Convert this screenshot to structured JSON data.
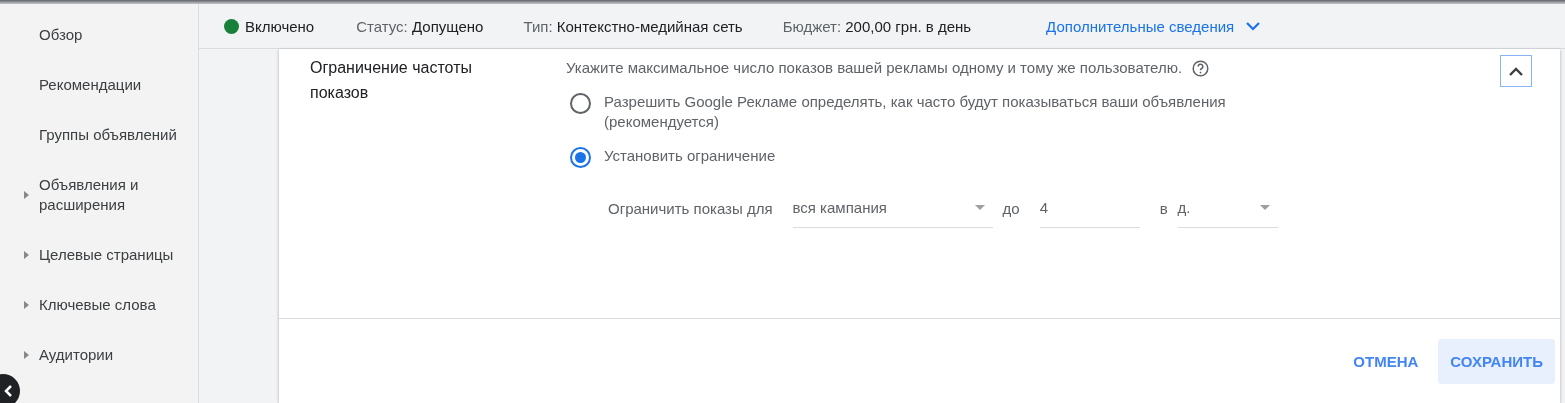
{
  "sidebar": {
    "items": [
      {
        "label": "Обзор",
        "expandable": false
      },
      {
        "label": "Рекомендации",
        "expandable": false
      },
      {
        "label": "Группы объявлений",
        "expandable": false
      },
      {
        "label": "Объявления и расширения",
        "expandable": true
      },
      {
        "label": "Целевые страницы",
        "expandable": true
      },
      {
        "label": "Ключевые слова",
        "expandable": true
      },
      {
        "label": "Аудитории",
        "expandable": true
      }
    ]
  },
  "header": {
    "state": {
      "label": "Включено",
      "color": "#188038"
    },
    "facts": [
      {
        "name": "Статус:",
        "value": "Допущено"
      },
      {
        "name": "Тип:",
        "value": "Контекстно-медийная сеть"
      },
      {
        "name": "Бюджет:",
        "value": "200,00 грн. в день"
      }
    ],
    "details_link": "Дополнительные сведения"
  },
  "setting": {
    "title": "Ограничение частоты показов",
    "description": "Укажите максимальное число показов вашей рекламы одному и тому же пользователю.",
    "options": [
      {
        "label": "Разрешить Google Рекламе определять, как часто будут показываться ваши объявления (рекомендуется)",
        "selected": false
      },
      {
        "label": "Установить ограничение",
        "selected": true
      }
    ],
    "limit": {
      "label": "Ограничить показы для",
      "scope": "вся кампания",
      "to_label": "до",
      "count": "4",
      "per_label": "в",
      "period": "д."
    }
  },
  "buttons": {
    "cancel": "ОТМЕНА",
    "save": "СОХРАНИТЬ"
  }
}
